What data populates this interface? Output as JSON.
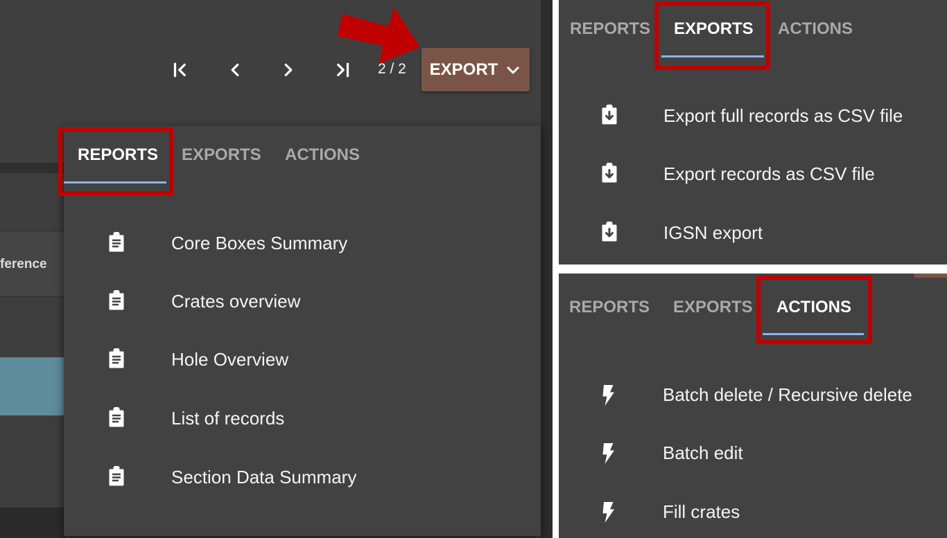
{
  "left_panel": {
    "background_column_header": "ference",
    "pager": {
      "first_icon": "first-page-icon",
      "prev_icon": "chevron-left-icon",
      "next_icon": "chevron-right-icon",
      "last_icon": "last-page-icon",
      "count": "2 / 2"
    },
    "export_button": {
      "label": "EXPORT",
      "icon": "chevron-down-icon",
      "color": "#7a5547"
    },
    "callout_arrow_color": "#c00000",
    "tabs": [
      {
        "label": "REPORTS",
        "active": true
      },
      {
        "label": "EXPORTS",
        "active": false
      },
      {
        "label": "ACTIONS",
        "active": false
      }
    ],
    "items": [
      {
        "label": "Core Boxes Summary",
        "icon": "clipboard-list-icon"
      },
      {
        "label": "Crates overview",
        "icon": "clipboard-list-icon"
      },
      {
        "label": "Hole Overview",
        "icon": "clipboard-list-icon"
      },
      {
        "label": "List of records",
        "icon": "clipboard-list-icon"
      },
      {
        "label": "Section Data Summary",
        "icon": "clipboard-list-icon"
      }
    ]
  },
  "exports_panel": {
    "tabs": [
      {
        "label": "REPORTS",
        "active": false
      },
      {
        "label": "EXPORTS",
        "active": true
      },
      {
        "label": "ACTIONS",
        "active": false
      }
    ],
    "items": [
      {
        "label": "Export full records as CSV file",
        "icon": "clipboard-download-icon"
      },
      {
        "label": "Export records as CSV file",
        "icon": "clipboard-download-icon"
      },
      {
        "label": "IGSN export",
        "icon": "clipboard-download-icon"
      }
    ]
  },
  "actions_panel": {
    "tabs": [
      {
        "label": "REPORTS",
        "active": false
      },
      {
        "label": "EXPORTS",
        "active": false
      },
      {
        "label": "ACTIONS",
        "active": true
      }
    ],
    "items": [
      {
        "label": "Batch delete / Recursive delete",
        "icon": "lightning-bolt-icon"
      },
      {
        "label": "Batch edit",
        "icon": "lightning-bolt-icon"
      },
      {
        "label": "Fill crates",
        "icon": "lightning-bolt-icon"
      }
    ]
  },
  "colors": {
    "panel_bg": "#424242",
    "highlight_box": "#c00000",
    "tab_underline": "#8ab4f8",
    "selected_row": "#5f8c9a"
  }
}
